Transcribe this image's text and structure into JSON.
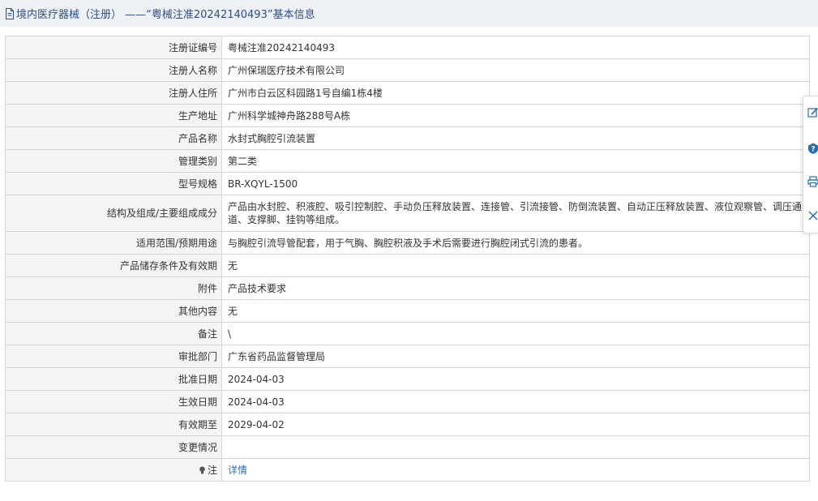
{
  "header": {
    "title": "境内医疗器械（注册） ——“粤械注准20242140493”基本信息"
  },
  "rows": [
    {
      "label": "注册证编号",
      "value": "粤械注准20242140493"
    },
    {
      "label": "注册人名称",
      "value": "广州保瑞医疗技术有限公司"
    },
    {
      "label": "注册人住所",
      "value": "广州市白云区科园路1号自编1栋4楼"
    },
    {
      "label": "生产地址",
      "value": "广州科学城神舟路288号A栋"
    },
    {
      "label": "产品名称",
      "value": "水封式胸腔引流装置"
    },
    {
      "label": "管理类别",
      "value": "第二类"
    },
    {
      "label": "型号规格",
      "value": "BR-XQYL-1500"
    },
    {
      "label": "结构及组成/主要组成成分",
      "value": "产品由水封腔、积液腔、吸引控制腔、手动负压释放装置、连接管、引流接管、防倒流装置、自动正压释放装置、液位观察管、调压通道、支撑脚、挂钩等组成。"
    },
    {
      "label": "适用范围/预期用途",
      "value": "与胸腔引流导管配套，用于气胸、胸腔积液及手术后需要进行胸腔闭式引流的患者。"
    },
    {
      "label": "产品储存条件及有效期",
      "value": "无"
    },
    {
      "label": "附件",
      "value": "产品技术要求"
    },
    {
      "label": "其他内容",
      "value": "无"
    },
    {
      "label": "备注",
      "value": "\\"
    },
    {
      "label": "审批部门",
      "value": "广东省药品监督管理局"
    },
    {
      "label": "批准日期",
      "value": "2024-04-03"
    },
    {
      "label": "生效日期",
      "value": "2024-04-03"
    },
    {
      "label": "有效期至",
      "value": "2029-04-02"
    },
    {
      "label": "变更情况",
      "value": ""
    }
  ],
  "note": {
    "label": "注",
    "link_text": "详情"
  },
  "sidebar": {
    "icons": [
      "edit-icon",
      "help-icon",
      "print-icon",
      "close-icon"
    ]
  }
}
